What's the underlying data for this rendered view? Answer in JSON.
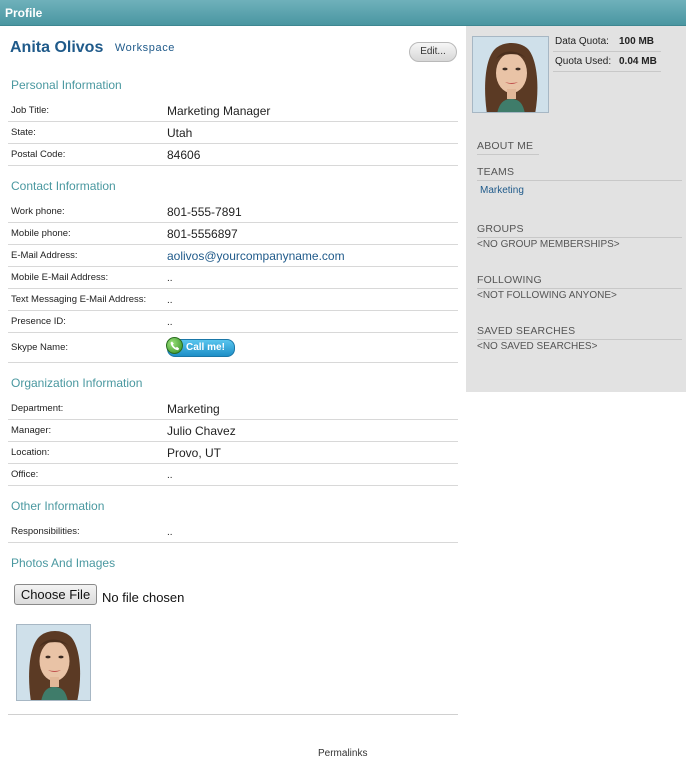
{
  "header": {
    "title": "Profile"
  },
  "profile": {
    "name": "Anita Olivos",
    "workspace_link": "Workspace",
    "edit_label": "Edit..."
  },
  "sections": {
    "personal": {
      "title": "Personal Information",
      "fields": [
        {
          "label": "Job Title:",
          "value": "Marketing Manager"
        },
        {
          "label": "State:",
          "value": "Utah"
        },
        {
          "label": "Postal Code:",
          "value": "84606"
        }
      ]
    },
    "contact": {
      "title": "Contact Information",
      "fields": [
        {
          "label": "Work phone:",
          "value": "801-555-7891"
        },
        {
          "label": "Mobile phone:",
          "value": "801-5556897"
        },
        {
          "label": "E-Mail Address:",
          "value": "aolivos@yourcompanyname.com"
        },
        {
          "label": "Mobile E-Mail Address:",
          "value": ".."
        },
        {
          "label": "Text Messaging E-Mail Address:",
          "value": ".."
        },
        {
          "label": "Presence ID:",
          "value": ".."
        },
        {
          "label": "Skype Name:",
          "button": "Call me!"
        }
      ]
    },
    "organization": {
      "title": "Organization Information",
      "fields": [
        {
          "label": "Department:",
          "value": "Marketing"
        },
        {
          "label": "Manager:",
          "value": "Julio Chavez"
        },
        {
          "label": "Location:",
          "value": "Provo, UT"
        },
        {
          "label": "Office:",
          "value": ".."
        }
      ]
    },
    "other": {
      "title": "Other Information",
      "fields": [
        {
          "label": "Responsibilities:",
          "value": ".."
        }
      ]
    },
    "photos": {
      "title": "Photos And Images",
      "choose_file_label": "Choose File",
      "file_status": "No file chosen"
    }
  },
  "footer": {
    "permalinks": "Permalinks"
  },
  "sidebar": {
    "quota": [
      {
        "label": "Data Quota:",
        "value": "100 MB"
      },
      {
        "label": "Quota Used:",
        "value": "0.04 MB"
      }
    ],
    "about_heading": "ABOUT ME",
    "teams_heading": "TEAMS",
    "teams_items": [
      "Marketing"
    ],
    "groups_heading": "GROUPS",
    "groups_empty": "<NO GROUP MEMBERSHIPS>",
    "following_heading": "FOLLOWING",
    "following_empty": "<NOT FOLLOWING ANYONE>",
    "saved_heading": "SAVED SEARCHES",
    "saved_empty": "<NO SAVED SEARCHES>"
  },
  "colors": {
    "header_bar": "#4a96a1",
    "section_title": "#4a98a0",
    "link": "#1f5a8a",
    "sidebar_bg": "#e2e2e2"
  }
}
